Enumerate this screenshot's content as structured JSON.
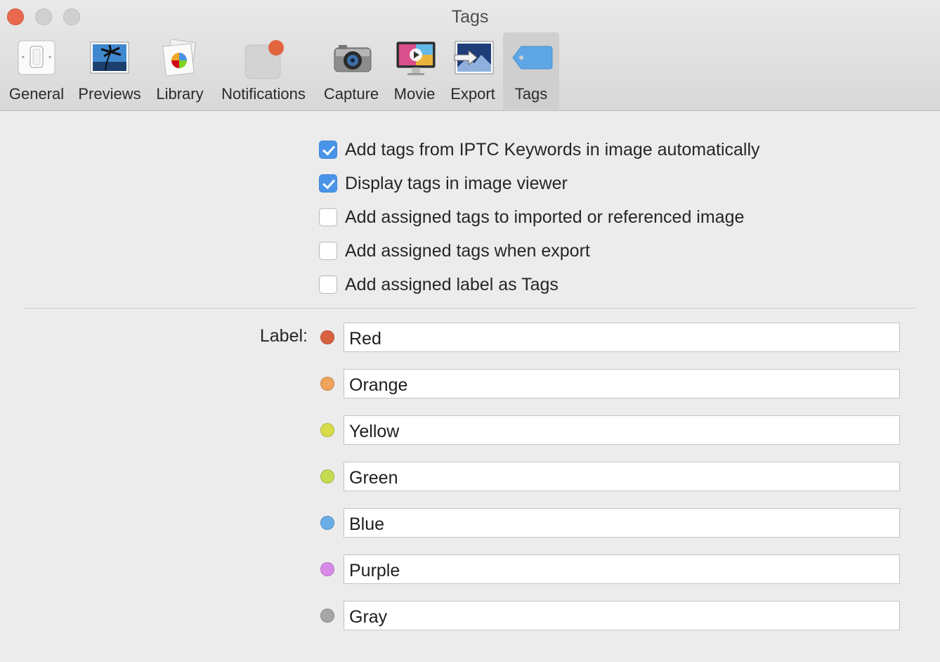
{
  "window": {
    "title": "Tags"
  },
  "toolbar": {
    "tabs": [
      {
        "label": "General"
      },
      {
        "label": "Previews"
      },
      {
        "label": "Library"
      },
      {
        "label": "Notifications"
      },
      {
        "label": "Capture"
      },
      {
        "label": "Movie"
      },
      {
        "label": "Export"
      },
      {
        "label": "Tags"
      }
    ],
    "selected": "Tags"
  },
  "options": [
    {
      "label": "Add tags from IPTC Keywords in image automatically",
      "checked": true
    },
    {
      "label": "Display tags in image viewer",
      "checked": true
    },
    {
      "label": "Add assigned tags to imported or referenced image",
      "checked": false
    },
    {
      "label": "Add assigned tags when export",
      "checked": false
    },
    {
      "label": "Add assigned label as Tags",
      "checked": false
    }
  ],
  "labels": {
    "title": "Label:",
    "items": [
      {
        "value": "Red",
        "color": "#d9603f"
      },
      {
        "value": "Orange",
        "color": "#f0a35a"
      },
      {
        "value": "Yellow",
        "color": "#d8dc4a"
      },
      {
        "value": "Green",
        "color": "#c5dc52"
      },
      {
        "value": "Blue",
        "color": "#6aaee8"
      },
      {
        "value": "Purple",
        "color": "#d98ae8"
      },
      {
        "value": "Gray",
        "color": "#a6a6a6"
      }
    ]
  }
}
